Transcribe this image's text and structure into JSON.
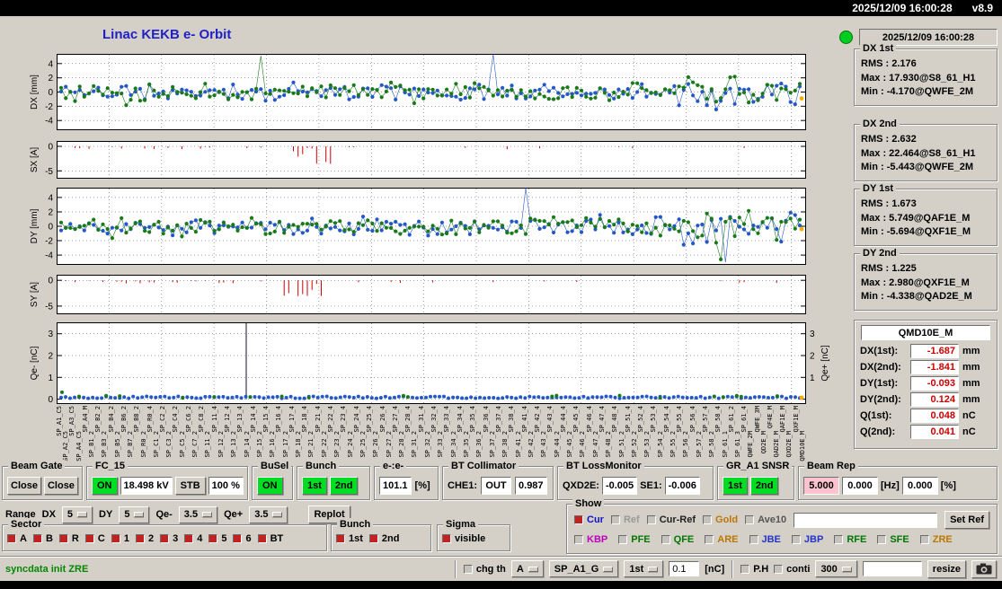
{
  "titlebar": {
    "clock": "2025/12/09 16:00:28",
    "version": "v8.9"
  },
  "title": "Linac KEKB e- Orbit",
  "ui_colors": {
    "on_green": "#00dd22",
    "pink": "#ffc3cf",
    "value_red": "#cc0000",
    "title_blue": "#2020c8",
    "status_green": "#008800",
    "lamp_green": "#00cc22",
    "checked_box": "#c22222"
  },
  "right_panel": {
    "time": "2025/12/09 16:00:28",
    "stats": [
      {
        "label": "DX 1st",
        "lines": [
          "RMS : 2.176",
          "Max : 17.930@S8_61_H1",
          "Min : -4.170@QWFE_2M"
        ]
      },
      {
        "label": "DX 2nd",
        "lines": [
          "RMS : 2.632",
          "Max : 22.464@S8_61_H1",
          "Min : -5.443@QWFE_2M"
        ]
      },
      {
        "label": "DY 1st",
        "lines": [
          "RMS : 1.673",
          "Max : 5.749@QAF1E_M",
          "Min : -5.694@QXF1E_M"
        ]
      },
      {
        "label": "DY 2nd",
        "lines": [
          "RMS : 1.225",
          "Max : 2.980@QXF1E_M",
          "Min : -4.338@QAD2E_M"
        ]
      }
    ],
    "monitor": {
      "title": "QMD10E_M",
      "rows": [
        {
          "label": "DX(1st):",
          "value": "-1.687",
          "unit": "mm"
        },
        {
          "label": "DX(2nd):",
          "value": "-1.841",
          "unit": "mm"
        },
        {
          "label": "DY(1st):",
          "value": "-0.093",
          "unit": "mm"
        },
        {
          "label": "DY(2nd):",
          "value": "0.124",
          "unit": "mm"
        },
        {
          "label": "Q(1st):",
          "value": "0.048",
          "unit": "nC"
        },
        {
          "label": "Q(2nd):",
          "value": "0.041",
          "unit": "nC"
        }
      ]
    }
  },
  "plots": {
    "dx": {
      "ylabel": "DX [mm]",
      "yticks": [
        4,
        2,
        0,
        -2,
        -4
      ],
      "ylim": [
        -5.3,
        5.3
      ]
    },
    "sx": {
      "ylabel": "SX [A]",
      "yticks": [
        0,
        -5
      ],
      "ylim": [
        -6.5,
        1.0
      ]
    },
    "dy": {
      "ylabel": "DY [mm]",
      "yticks": [
        4,
        2,
        0,
        -2,
        -4
      ],
      "ylim": [
        -5.3,
        5.3
      ]
    },
    "sy": {
      "ylabel": "SY [A]",
      "yticks": [
        0,
        -5
      ],
      "ylim": [
        -6.5,
        1.0
      ]
    },
    "q": {
      "ylabel": "Qe- [nC]",
      "ylabel_right": "Qe+ [nC]",
      "yticks": [
        3,
        2,
        1,
        0
      ],
      "right_ticks": [
        3,
        2,
        1
      ],
      "ylim": [
        -0.2,
        3.5
      ]
    },
    "colors": {
      "first_bunch": "#1a7a1a",
      "second_bunch": "#2458c8",
      "steering": "#cc0000",
      "latest_point": "#ffaa00"
    }
  },
  "xticks": [
    "SP_A1_C5",
    "SP_A2_C5",
    "SP_A3_C5",
    "SP_A4_C5",
    "SP_A4_M",
    "SP_B1_2",
    "SP_B2_2",
    "SP_B3_2",
    "SP_B4_2",
    "SP_B5_2",
    "SP_B6_2",
    "SP_B7_2",
    "SP_B8_2",
    "SP_R0_2",
    "SP_R0_4",
    "SP_C1_2",
    "SP_C2_2",
    "SP_C3_2",
    "SP_C4_2",
    "SP_C5_2",
    "SP_C6_2",
    "SP_C7_2",
    "SP_C8_2",
    "SP_11_2",
    "SP_11_4",
    "SP_12_2",
    "SP_12_4",
    "SP_13_2",
    "SP_13_4",
    "SP_14_2",
    "SP_14_4",
    "SP_15_2",
    "SP_15_4",
    "SP_16_2",
    "SP_16_4",
    "SP_17_2",
    "SP_17_4",
    "SP_18_2",
    "SP_18_4",
    "SP_21_2",
    "SP_21_4",
    "SP_22_2",
    "SP_22_4",
    "SP_23_2",
    "SP_23_4",
    "SP_24_2",
    "SP_24_4",
    "SP_25_2",
    "SP_25_4",
    "SP_26_2",
    "SP_26_4",
    "SP_27_2",
    "SP_27_4",
    "SP_28_2",
    "SP_28_4",
    "SP_31_2",
    "SP_31_4",
    "SP_32_2",
    "SP_32_4",
    "SP_33_2",
    "SP_33_4",
    "SP_34_2",
    "SP_34_4",
    "SP_35_2",
    "SP_35_4",
    "SP_36_2",
    "SP_36_4",
    "SP_37_2",
    "SP_37_4",
    "SP_38_2",
    "SP_38_4",
    "SP_41_2",
    "SP_41_4",
    "SP_42_2",
    "SP_42_4",
    "SP_43_2",
    "SP_43_4",
    "SP_44_2",
    "SP_44_4",
    "SP_45_2",
    "SP_45_4",
    "SP_46_2",
    "SP_46_4",
    "SP_47_2",
    "SP_47_4",
    "SP_48_2",
    "SP_48_4",
    "SP_51_2",
    "SP_51_4",
    "SP_52_2",
    "SP_52_4",
    "SP_53_2",
    "SP_53_4",
    "SP_54_2",
    "SP_54_4",
    "SP_55_2",
    "SP_55_4",
    "SP_56_2",
    "SP_56_4",
    "SP_57_2",
    "SP_57_4",
    "SP_58_2",
    "SP_58_4",
    "SP_61_1",
    "SP_61_2",
    "SP_61_3",
    "SP_61_4",
    "QWFE_2M",
    "QWFE_3M",
    "QD2E_M",
    "QF4E_M",
    "QAD2E_M",
    "QAF1E_M",
    "QXD2E_M",
    "QXF1E_M",
    "QMD10E_M"
  ],
  "controls": {
    "beam_gate": {
      "label": "Beam Gate",
      "buttons": [
        "Close",
        "Close"
      ]
    },
    "fc15": {
      "label": "FC_15",
      "on": "ON",
      "kv": "18.498 kV",
      "stb": "STB",
      "pct": "100 %"
    },
    "busel": {
      "label": "BuSel",
      "on": "ON"
    },
    "bunch": {
      "label": "Bunch",
      "b1": "1st",
      "b2": "2nd"
    },
    "ee": {
      "label": "e-:e-",
      "value": "101.1",
      "unit": "[%]"
    },
    "bt_collimator": {
      "label": "BT Collimator",
      "che1_label": "CHE1:",
      "che1": "OUT",
      "value": "0.987"
    },
    "bt_lossmonitor": {
      "label": "BT LossMonitor",
      "qxd2e_label": "QXD2E:",
      "qxd2e": "-0.005",
      "se1_label": "SE1:",
      "se1": "-0.006"
    },
    "gr_a1_snsr": {
      "label": "GR_A1 SNSR",
      "b1": "1st",
      "b2": "2nd"
    },
    "beam_rep": {
      "label": "Beam Rep",
      "v1": "5.000",
      "v2": "0.000",
      "u1": "[Hz]",
      "v3": "0.000",
      "u2": "[%]"
    }
  },
  "range_row": {
    "range_label": "Range",
    "dx_label": "DX",
    "dx": "5",
    "dy_label": "DY",
    "dy": "5",
    "qem_label": "Qe-",
    "qem": "3.5",
    "qep_label": "Qe+",
    "qep": "3.5",
    "replot": "Replot"
  },
  "sector": {
    "label": "Sector",
    "items": [
      "A",
      "B",
      "R",
      "C",
      "1",
      "2",
      "3",
      "4",
      "5",
      "6",
      "BT"
    ]
  },
  "bunch_sel": {
    "label": "Bunch",
    "items": [
      "1st",
      "2nd"
    ]
  },
  "sigma": {
    "label": "Sigma",
    "item": "visible"
  },
  "show": {
    "label": "Show",
    "row1": [
      {
        "label": "Cur",
        "color": "#1111cc",
        "checked": true
      },
      {
        "label": "Ref",
        "color": "#999999",
        "checked": false
      },
      {
        "label": "Cur-Ref",
        "color": "#222222",
        "checked": false
      },
      {
        "label": "Gold",
        "color": "#bb7700",
        "checked": false
      },
      {
        "label": "Ave10",
        "color": "#555555",
        "checked": false
      }
    ],
    "ref_input": "",
    "set_ref": "Set Ref",
    "row2": [
      {
        "label": "KBP",
        "color": "#bb00bb",
        "checked": false
      },
      {
        "label": "PFE",
        "color": "#007700",
        "checked": false
      },
      {
        "label": "QFE",
        "color": "#007700",
        "checked": false
      },
      {
        "label": "ARE",
        "color": "#bb7700",
        "checked": false
      },
      {
        "label": "JBE",
        "color": "#2233cc",
        "checked": false
      },
      {
        "label": "JBP",
        "color": "#2233cc",
        "checked": false
      },
      {
        "label": "RFE",
        "color": "#007700",
        "checked": false
      },
      {
        "label": "SFE",
        "color": "#007700",
        "checked": false
      },
      {
        "label": "ZRE",
        "color": "#bb7700",
        "checked": false
      }
    ]
  },
  "statusbar": {
    "message": "syncdata init ZRE",
    "chg_th": "chg th",
    "dd_a": "A",
    "dd_sp": "SP_A1_G",
    "dd_1st": "1st",
    "th_value": "0.1",
    "th_unit": "[nC]",
    "ph": "P.H",
    "conti": "conti",
    "dd_300": "300",
    "extra_input": "",
    "resize": "resize"
  }
}
